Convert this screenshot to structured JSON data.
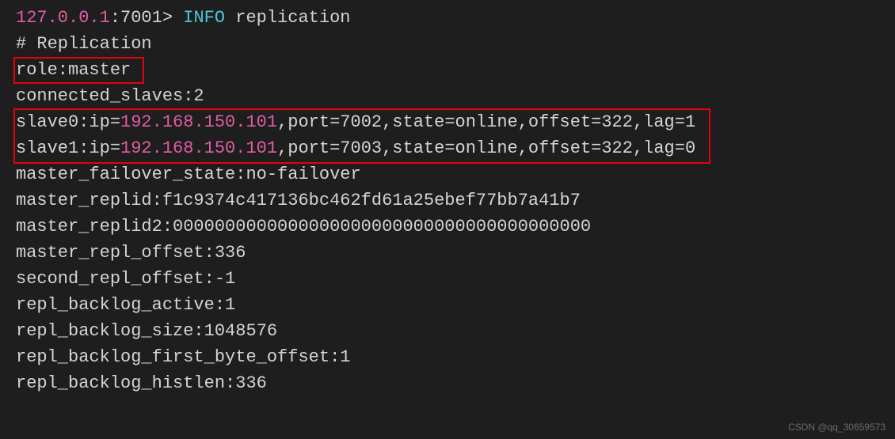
{
  "prompt": {
    "host": "127.0.0.1",
    "port": ":7001>",
    "command_keyword": " INFO",
    "command_arg": " replication"
  },
  "lines": {
    "header": "# Replication",
    "role": "role:master",
    "connected_slaves": "connected_slaves:2",
    "slave0_prefix": "slave0:ip=",
    "slave0_ip": "192.168.150.101",
    "slave0_rest": ",port=7002,state=online,offset=322,lag=1",
    "slave1_prefix": "slave1:ip=",
    "slave1_ip": "192.168.150.101",
    "slave1_rest": ",port=7003,state=online,offset=322,lag=0",
    "master_failover_state": "master_failover_state:no-failover",
    "master_replid": "master_replid:f1c9374c417136bc462fd61a25ebef77bb7a41b7",
    "master_replid2": "master_replid2:0000000000000000000000000000000000000000",
    "master_repl_offset": "master_repl_offset:336",
    "second_repl_offset": "second_repl_offset:-1",
    "repl_backlog_active": "repl_backlog_active:1",
    "repl_backlog_size": "repl_backlog_size:1048576",
    "repl_backlog_first_byte_offset": "repl_backlog_first_byte_offset:1",
    "repl_backlog_histlen": "repl_backlog_histlen:336"
  },
  "watermark": "CSDN @qq_30659573"
}
